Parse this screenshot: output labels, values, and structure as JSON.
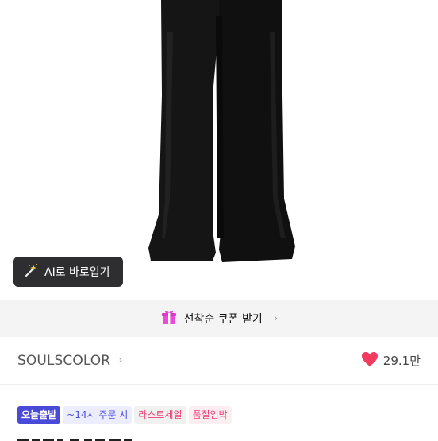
{
  "ai_button": {
    "label": "AI로 바로입기"
  },
  "coupon": {
    "label": "선착순 쿠폰 받기"
  },
  "brand": {
    "name": "SOULSCOLOR",
    "likes": "29.1만"
  },
  "tags": [
    "오늘출발",
    "~14시 주문 시",
    "라스트세일",
    "품절임박"
  ],
  "colors": {
    "accent_blue": "#4a4ad8",
    "accent_pink": "#ee3d73",
    "heart": "#f23b5f"
  }
}
